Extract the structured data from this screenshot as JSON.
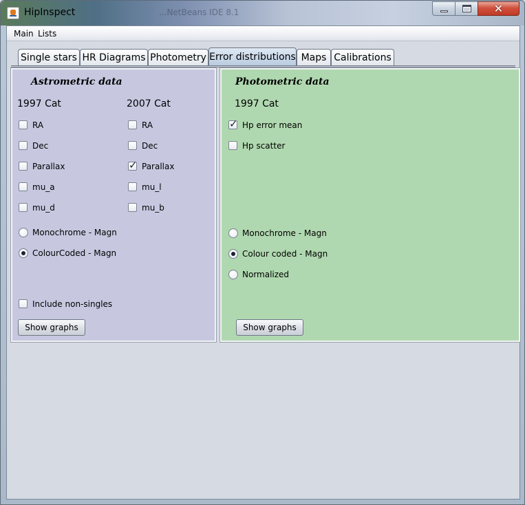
{
  "window": {
    "title": "HipInspect",
    "background_app_text": "...NetBeans IDE 8.1"
  },
  "menu": {
    "main": "Main",
    "lists": "Lists"
  },
  "tabs": [
    {
      "label": "Single stars",
      "active": false
    },
    {
      "label": "HR Diagrams",
      "active": false
    },
    {
      "label": "Photometry",
      "active": false
    },
    {
      "label": "Error distributions",
      "active": true
    },
    {
      "label": "Maps",
      "active": false
    },
    {
      "label": "Calibrations",
      "active": false
    }
  ],
  "astrometric": {
    "heading": "Astrometric data",
    "col1997": {
      "label": "1997 Cat",
      "items": [
        {
          "label": "RA",
          "checked": false
        },
        {
          "label": "Dec",
          "checked": false
        },
        {
          "label": "Parallax",
          "checked": false
        },
        {
          "label": "mu_a",
          "checked": false
        },
        {
          "label": "mu_d",
          "checked": false
        }
      ]
    },
    "col2007": {
      "label": "2007 Cat",
      "items": [
        {
          "label": "RA",
          "checked": false
        },
        {
          "label": "Dec",
          "checked": false
        },
        {
          "label": "Parallax",
          "checked": true
        },
        {
          "label": "mu_l",
          "checked": false
        },
        {
          "label": "mu_b",
          "checked": false
        }
      ]
    },
    "radios": [
      {
        "label": "Monochrome - Magn",
        "selected": false
      },
      {
        "label": "ColourCoded - Magn",
        "selected": true
      }
    ],
    "include_non_singles": {
      "label": "Include non-singles",
      "checked": false
    },
    "show_graphs": "Show graphs",
    "background_color": "#c7c8e0"
  },
  "photometric": {
    "heading": "Photometric data",
    "cat_label": "1997 Cat",
    "items": [
      {
        "label": "Hp error mean",
        "checked": true
      },
      {
        "label": "Hp scatter",
        "checked": false
      }
    ],
    "radios": [
      {
        "label": "Monochrome - Magn",
        "selected": false
      },
      {
        "label": "Colour coded - Magn",
        "selected": true
      },
      {
        "label": "Normalized",
        "selected": false
      }
    ],
    "show_graphs": "Show graphs",
    "background_color": "#b0d8b0"
  }
}
